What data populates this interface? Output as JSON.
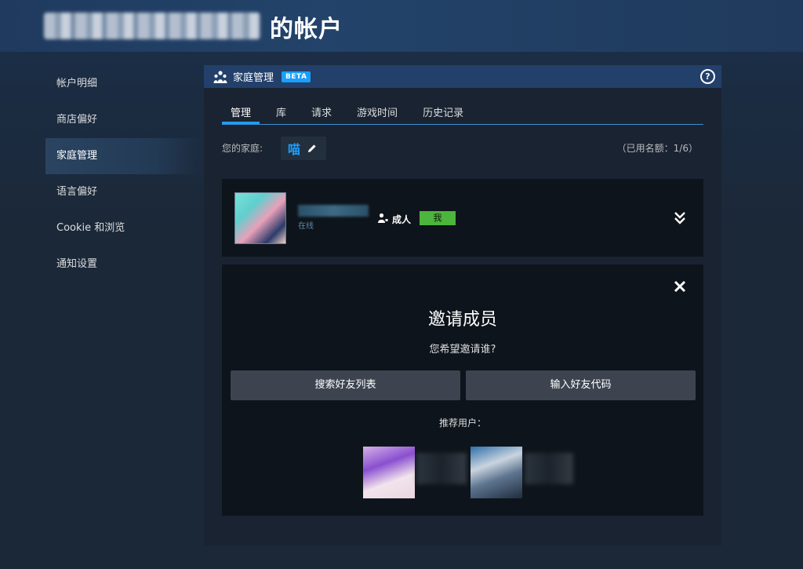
{
  "header": {
    "title": "的帐户"
  },
  "sidebar": {
    "items": [
      {
        "label": "帐户明细"
      },
      {
        "label": "商店偏好"
      },
      {
        "label": "家庭管理"
      },
      {
        "label": "语言偏好"
      },
      {
        "label": "Cookie 和浏览"
      },
      {
        "label": "通知设置"
      }
    ],
    "active_index": 2
  },
  "panel": {
    "title": "家庭管理",
    "badge": "BETA",
    "help": "?",
    "tabs": [
      {
        "label": "管理"
      },
      {
        "label": "库"
      },
      {
        "label": "请求"
      },
      {
        "label": "游戏时间"
      },
      {
        "label": "历史记录"
      }
    ],
    "active_tab": 0
  },
  "family": {
    "label": "您的家庭:",
    "name": "喵",
    "slots": "（已用名额：1/6）"
  },
  "member": {
    "status": "在线",
    "role": "成人",
    "badge": "我"
  },
  "invite": {
    "title": "邀请成员",
    "subtitle": "您希望邀请谁?",
    "search_button": "搜索好友列表",
    "code_button": "输入好友代码",
    "recommended_label": "推荐用户："
  },
  "colors": {
    "accent": "#1a9fff",
    "me_badge": "#4cb53c",
    "panel_header": "#22406a",
    "card_bg": "#0e141b"
  },
  "icons": {
    "family": "family-icon",
    "help": "help-icon",
    "edit": "pencil-icon",
    "role": "person-icon",
    "expand": "double-chevron-down-icon",
    "close": "close-icon"
  }
}
